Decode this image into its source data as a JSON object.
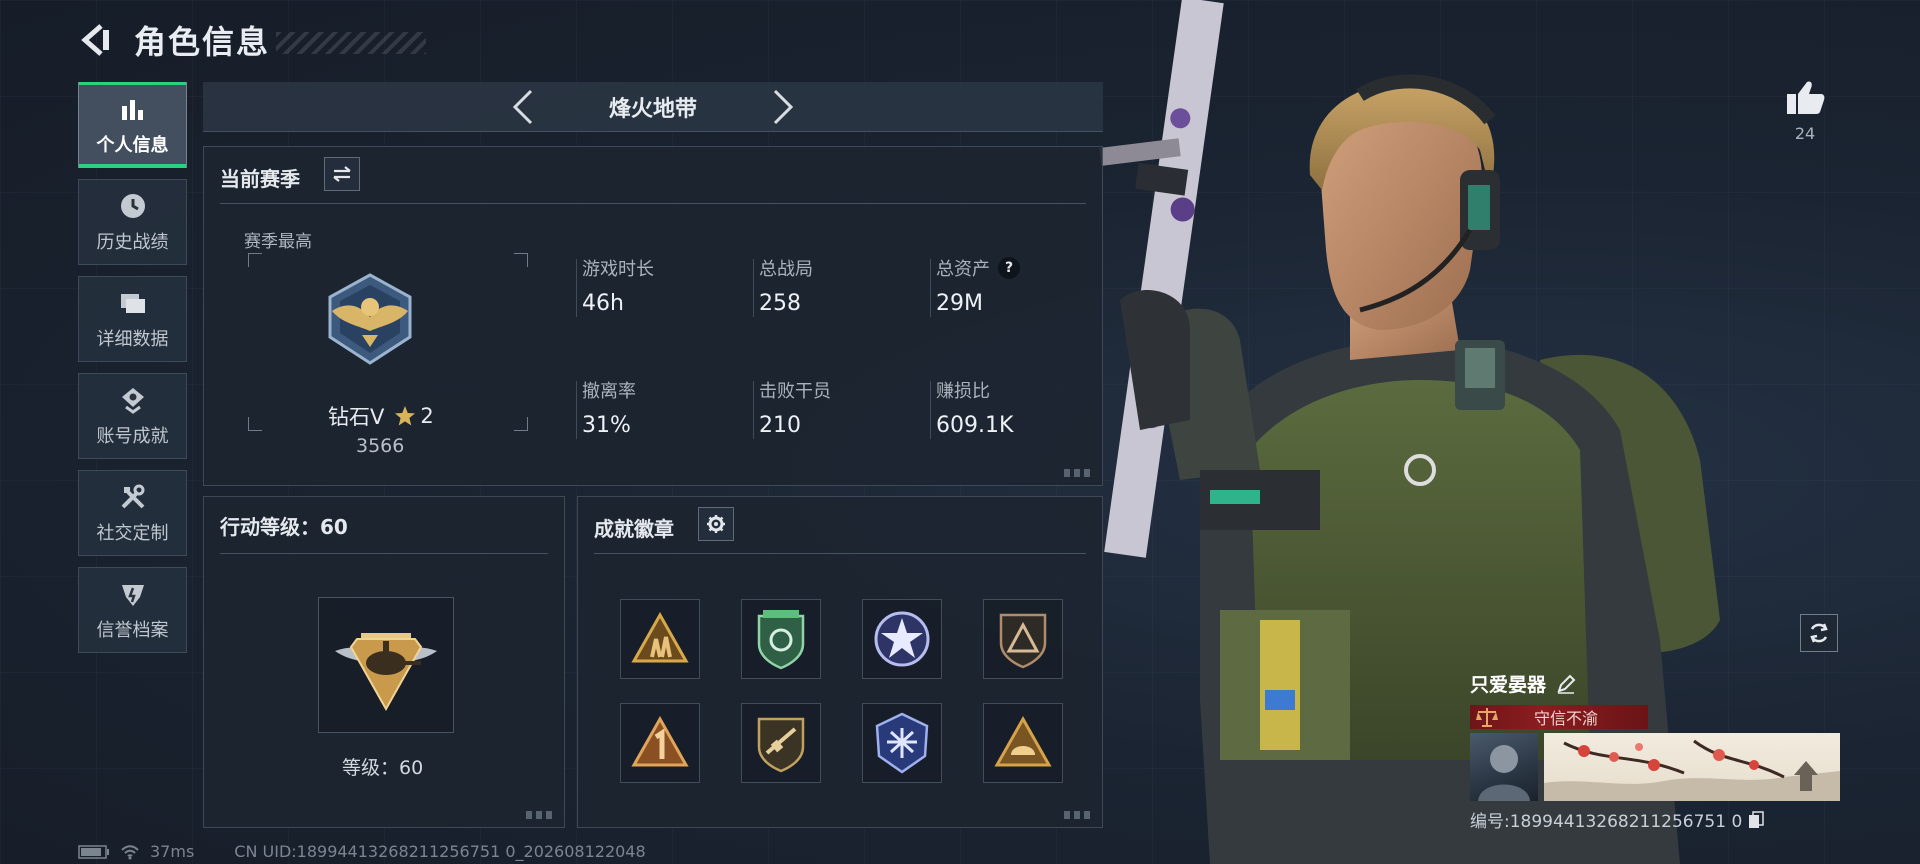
{
  "header": {
    "title": "角色信息"
  },
  "sidebar": {
    "items": [
      {
        "label": "个人信息",
        "icon": "bar-chart-icon",
        "active": true
      },
      {
        "label": "历史战绩",
        "icon": "clock-icon",
        "active": false
      },
      {
        "label": "详细数据",
        "icon": "folder-icon",
        "active": false
      },
      {
        "label": "账号成就",
        "icon": "achievement-icon",
        "active": false
      },
      {
        "label": "社交定制",
        "icon": "wrench-icon",
        "active": false
      },
      {
        "label": "信誉档案",
        "icon": "shield-icon",
        "active": false
      }
    ]
  },
  "mode": {
    "name": "烽火地带"
  },
  "season": {
    "title": "当前赛季",
    "best_label": "赛季最高",
    "rank_name": "钻石V",
    "rank_stars": "2",
    "rank_score": "3566",
    "stats": [
      {
        "label": "游戏时长",
        "value": "46h"
      },
      {
        "label": "总战局",
        "value": "258"
      },
      {
        "label": "总资产",
        "value": "29M",
        "help": "?"
      },
      {
        "label": "撤离率",
        "value": "31%"
      },
      {
        "label": "击败干员",
        "value": "210"
      },
      {
        "label": "赚损比",
        "value": "609.1K"
      }
    ]
  },
  "level": {
    "title": "行动等级：60",
    "level_text": "等级：60"
  },
  "badges": {
    "title": "成就徽章",
    "items": [
      {
        "icon": "soldiers-triangle-badge",
        "color": "#d8a94a"
      },
      {
        "icon": "green-shield-badge",
        "color": "#5fbf7a"
      },
      {
        "icon": "star-circle-badge",
        "color": "#7f86d8"
      },
      {
        "icon": "dark-triangle-shield-badge",
        "color": "#b08c6a"
      },
      {
        "icon": "number-one-triangle-badge",
        "color": "#c98a3c"
      },
      {
        "icon": "rifle-shield-badge",
        "color": "#c2a060"
      },
      {
        "icon": "blue-emblem-badge",
        "color": "#5a70c8"
      },
      {
        "icon": "helmet-triangle-badge",
        "color": "#d6a24a"
      }
    ]
  },
  "profile": {
    "likes": "24",
    "player_name": "只爱晏器",
    "reputation": "守信不渝",
    "card_id": "编号:18994413268211256751 0"
  },
  "status": {
    "ping": "37ms",
    "uid": "CN UID:18994413268211256751 0_202608122048"
  },
  "colors": {
    "accent_green": "#27d37d",
    "rep_red": "#8a1d20"
  }
}
